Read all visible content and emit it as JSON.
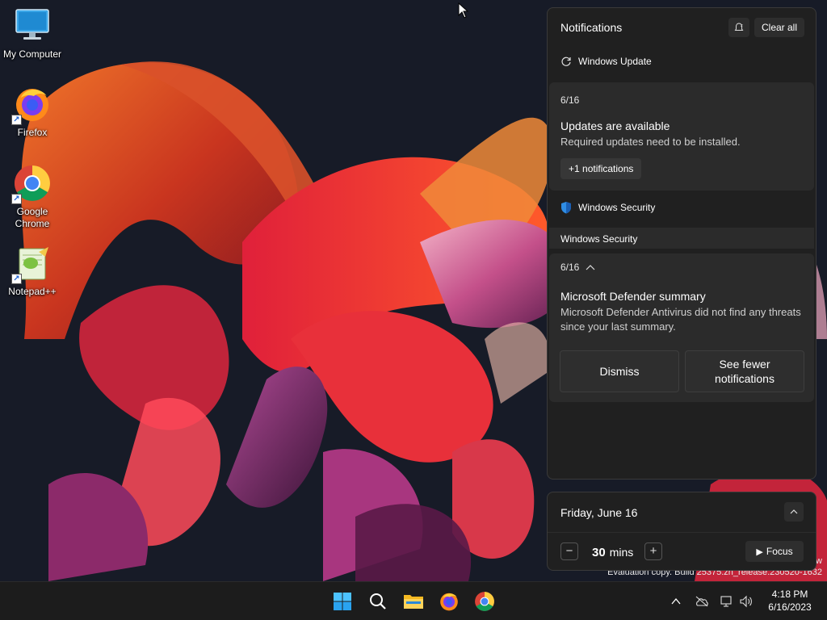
{
  "desktop": {
    "icons": [
      {
        "label": "My Computer"
      },
      {
        "label": "Firefox"
      },
      {
        "label": "Google Chrome"
      },
      {
        "label": "Notepad++"
      }
    ],
    "watermark_line1": "w",
    "watermark_line2": "Evaluation copy. Build 25375.zn_release.230520-1632"
  },
  "notifications": {
    "title": "Notifications",
    "clear_all_label": "Clear all",
    "groups": [
      {
        "app": "Windows Update",
        "date": "6/16",
        "card_title": "Updates are available",
        "card_body": "Required updates need to be installed.",
        "more_label": "+1 notifications"
      },
      {
        "app": "Windows Security",
        "strip_label": "Windows Security",
        "date": "6/16",
        "card_title": "Microsoft Defender summary",
        "card_body": "Microsoft Defender Antivirus did not find any threats since your last summary.",
        "dismiss_label": "Dismiss",
        "fewer_label": "See fewer notifications"
      }
    ]
  },
  "calendar": {
    "date_label": "Friday, June 16",
    "focus_minutes": "30",
    "focus_unit": "mins",
    "focus_label": "Focus"
  },
  "taskbar": {
    "apps": [
      "start",
      "search",
      "file-explorer",
      "firefox",
      "chrome"
    ],
    "clock_time": "4:18 PM",
    "clock_date": "6/16/2023"
  },
  "colors": {
    "panel_bg": "#202020",
    "card_bg": "#2b2b2b",
    "taskbar_bg": "#1c1c1c",
    "accent": "#0078d4"
  }
}
